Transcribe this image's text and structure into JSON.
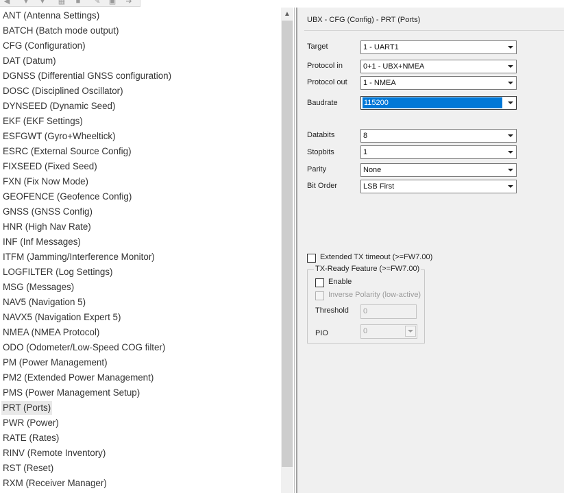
{
  "toolbar": {
    "icons": [
      "arrow-left-icon",
      "arrow-down-icon",
      "arrow-down-icon",
      "grid-icon",
      "save-icon",
      "edit-icon",
      "export-icon",
      "forward-icon"
    ]
  },
  "message_list": {
    "items": [
      "ANT (Antenna Settings)",
      "BATCH (Batch mode output)",
      "CFG (Configuration)",
      "DAT (Datum)",
      "DGNSS (Differential GNSS configuration)",
      "DOSC (Disciplined Oscillator)",
      "DYNSEED (Dynamic Seed)",
      "EKF (EKF Settings)",
      "ESFGWT (Gyro+Wheeltick)",
      "ESRC (External Source Config)",
      "FIXSEED (Fixed Seed)",
      "FXN (Fix Now Mode)",
      "GEOFENCE (Geofence Config)",
      "GNSS (GNSS Config)",
      "HNR (High Nav Rate)",
      "INF (Inf Messages)",
      "ITFM (Jamming/Interference Monitor)",
      "LOGFILTER (Log Settings)",
      "MSG (Messages)",
      "NAV5 (Navigation 5)",
      "NAVX5 (Navigation Expert 5)",
      "NMEA (NMEA Protocol)",
      "ODO (Odometer/Low-Speed COG filter)",
      "PM (Power Management)",
      "PM2 (Extended Power Management)",
      "PMS (Power Management Setup)",
      "PRT (Ports)",
      "PWR (Power)",
      "RATE (Rates)",
      "RINV (Remote Inventory)",
      "RST (Reset)",
      "RXM (Receiver Manager)"
    ],
    "selected_index": 26
  },
  "config": {
    "title": "UBX - CFG (Config) - PRT (Ports)",
    "fields": {
      "target": {
        "label": "Target",
        "value": "1 - UART1"
      },
      "protocol_in": {
        "label": "Protocol in",
        "value": "0+1 - UBX+NMEA"
      },
      "protocol_out": {
        "label": "Protocol out",
        "value": "1 - NMEA"
      },
      "baudrate": {
        "label": "Baudrate",
        "value": "115200"
      },
      "databits": {
        "label": "Databits",
        "value": "8"
      },
      "stopbits": {
        "label": "Stopbits",
        "value": "1"
      },
      "parity": {
        "label": "Parity",
        "value": "None"
      },
      "bit_order": {
        "label": "Bit Order",
        "value": "LSB First"
      }
    },
    "extended_tx_timeout": {
      "label": "Extended TX timeout (>=FW7.00)",
      "checked": false
    },
    "tx_ready": {
      "group_title": "TX-Ready Feature (>=FW7.00)",
      "enable": {
        "label": "Enable",
        "checked": false
      },
      "inverse_polarity": {
        "label": "Inverse Polarity (low-active)",
        "checked": false
      },
      "threshold": {
        "label": "Threshold",
        "value": "0"
      },
      "pio": {
        "label": "PIO",
        "value": "0"
      }
    }
  }
}
